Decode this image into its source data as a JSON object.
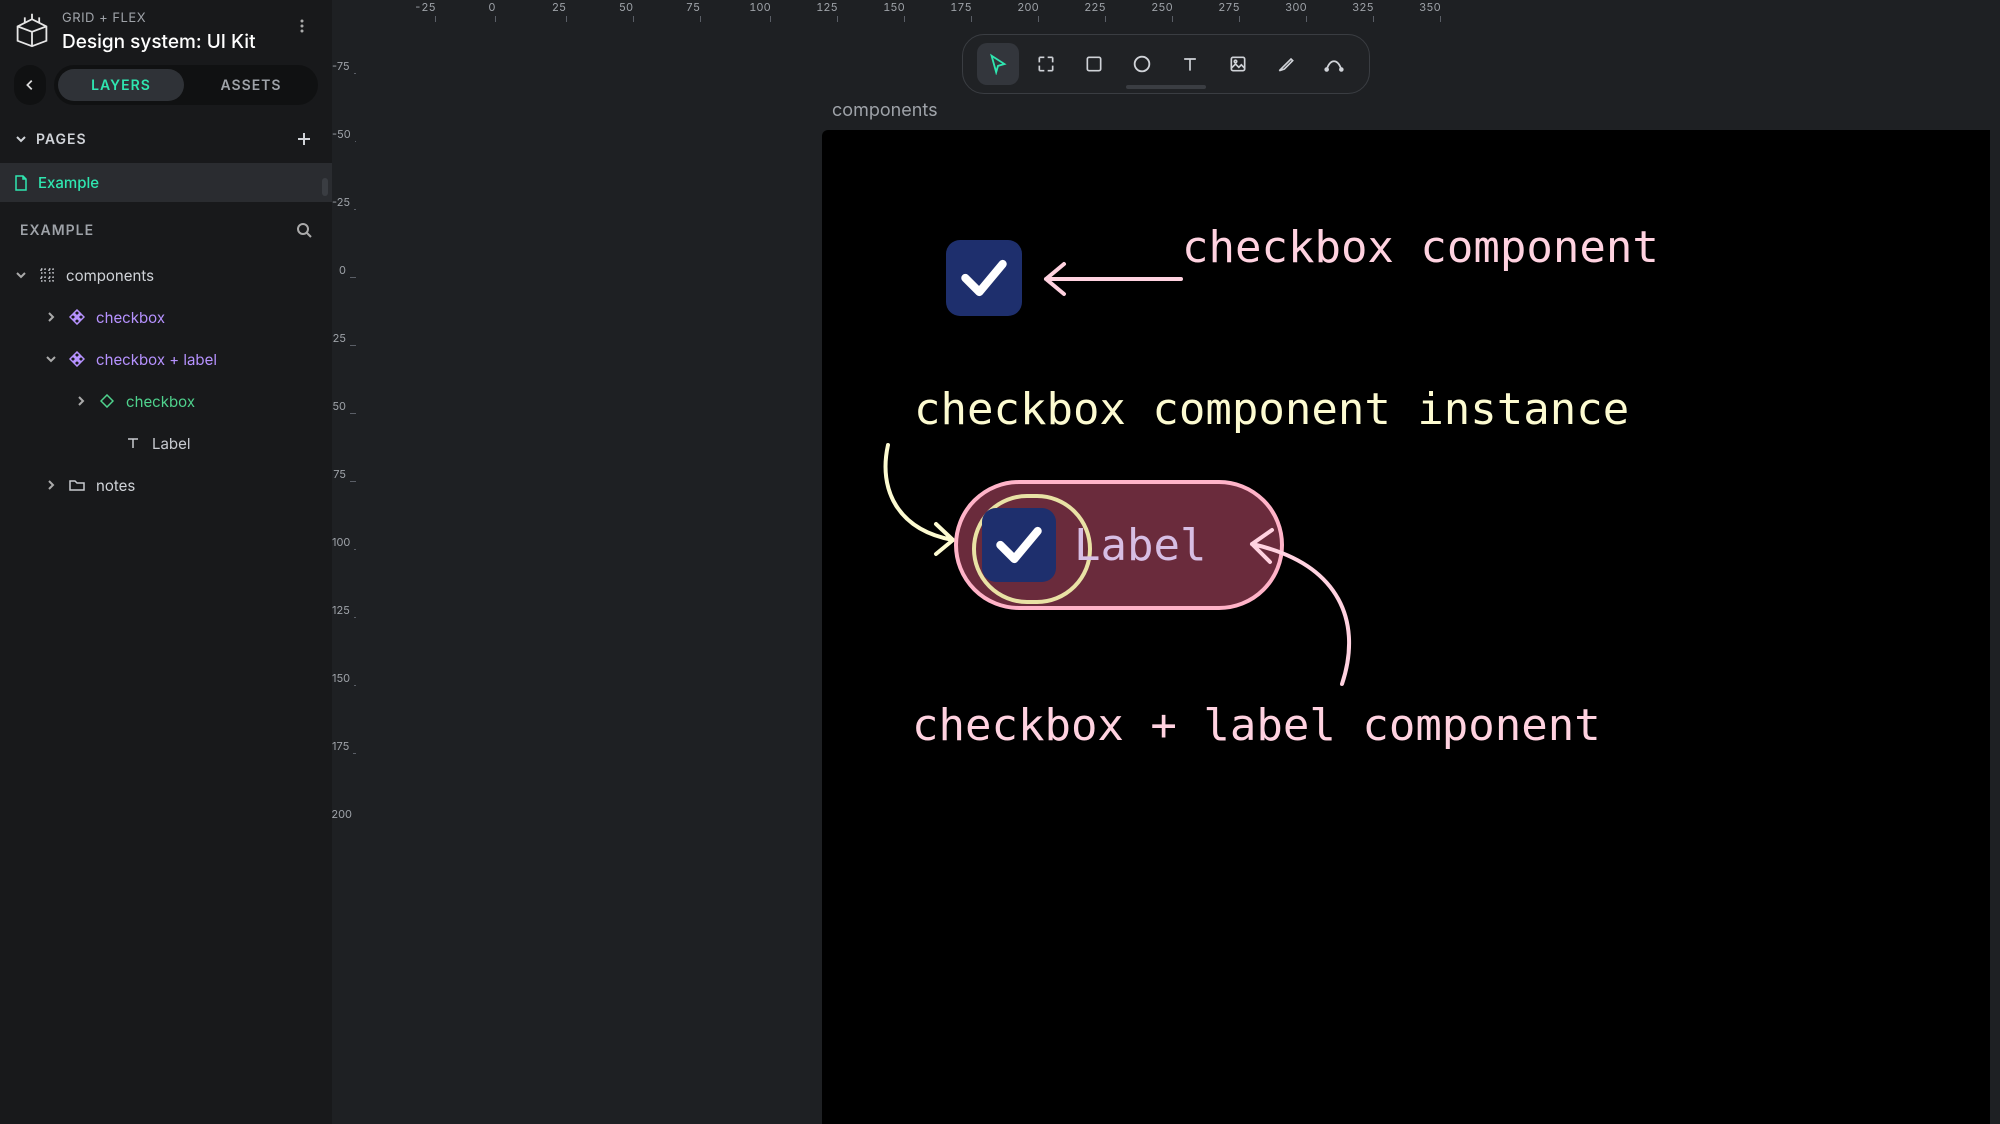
{
  "header": {
    "breadcrumb": "GRID + FLEX",
    "doc_title": "Design system: UI Kit"
  },
  "tabs": {
    "layers": "LAYERS",
    "assets": "ASSETS",
    "active": "layers"
  },
  "pages_section": {
    "title": "PAGES"
  },
  "pages": [
    {
      "label": "Example",
      "active": true
    }
  ],
  "layers_panel": {
    "title": "EXAMPLE"
  },
  "tree": {
    "root": {
      "label": "components"
    },
    "chk": {
      "label": "checkbox"
    },
    "chklbl": {
      "label": "checkbox + label"
    },
    "chkinst": {
      "label": "checkbox"
    },
    "lbl": {
      "label": "Label"
    },
    "notes": {
      "label": "notes"
    }
  },
  "frame": {
    "label": "components"
  },
  "toolbar": {
    "tools": [
      "select",
      "frame",
      "rectangle",
      "ellipse",
      "text",
      "image",
      "pen",
      "vector"
    ],
    "active": "select"
  },
  "canvas": {
    "anno_checkbox_component": "checkbox component",
    "anno_instance": "checkbox component instance",
    "anno_combo": "checkbox + label component",
    "label_text": "Label"
  },
  "ruler_h": [
    -25,
    0,
    25,
    50,
    75,
    100,
    125,
    150,
    175,
    200,
    225,
    250,
    275,
    300,
    325,
    350
  ],
  "ruler_v": [
    -75,
    -50,
    -25,
    0,
    25,
    50,
    75,
    100,
    125,
    150,
    175,
    200
  ]
}
